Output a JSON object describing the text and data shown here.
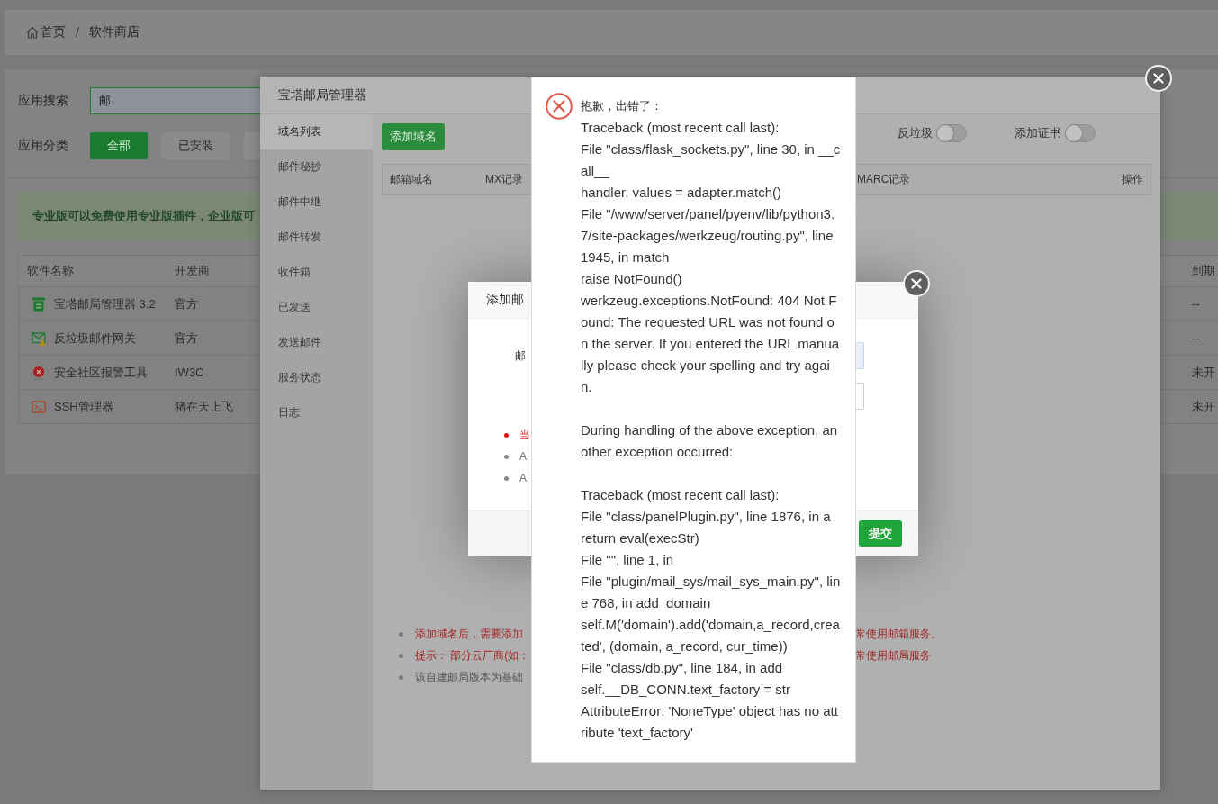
{
  "breadcrumb": {
    "items": [
      "首页",
      "软件商店"
    ],
    "separator": "/"
  },
  "search": {
    "label": "应用搜索",
    "value": "邮"
  },
  "category": {
    "label": "应用分类",
    "options": [
      {
        "label": "全部",
        "selected": true
      },
      {
        "label": "已安装",
        "selected": false
      },
      {
        "selected": false
      }
    ]
  },
  "banner": {
    "text": "专业版可以免费使用专业版插件，企业版可"
  },
  "software_table": {
    "columns": [
      "软件名称",
      "开发商"
    ],
    "column_right": "到期",
    "rows": [
      {
        "name": "宝塔邮局管理器 3.2",
        "developer": "官方",
        "expiry": "--"
      },
      {
        "name": "反垃圾邮件网关",
        "developer": "官方",
        "expiry": "--"
      },
      {
        "name": "安全社区报警工具",
        "developer": "IW3C",
        "expiry": "未开"
      },
      {
        "name": "SSH管理器",
        "developer": "猪在天上飞",
        "expiry": "未开"
      }
    ]
  },
  "mail_manager": {
    "title": "宝塔邮局管理器",
    "menu": [
      {
        "label": "域名列表",
        "selected": true
      },
      {
        "label": "邮件秘抄",
        "selected": false
      },
      {
        "label": "邮件中继",
        "selected": false
      },
      {
        "label": "邮件转发",
        "selected": false
      },
      {
        "label": "收件箱",
        "selected": false
      },
      {
        "label": "已发送",
        "selected": false
      },
      {
        "label": "发送邮件",
        "selected": false
      },
      {
        "label": "服务状态",
        "selected": false
      },
      {
        "label": "日志",
        "selected": false
      }
    ],
    "add_button": "添加域名",
    "switches": [
      {
        "label": "反垃圾",
        "on": false
      },
      {
        "label": "添加证书",
        "on": false
      }
    ],
    "columns_left": [
      "邮箱域名",
      "MX记录"
    ],
    "columns_right": [
      "MARC记录",
      "操作"
    ],
    "notes": [
      {
        "kind": "warning",
        "parts": [
          "添加域名后，需要添加",
          "常使用邮箱服务。"
        ]
      },
      {
        "kind": "warning",
        "parts": [
          "提示： 部分云厂商(如：",
          "常使用邮局服务"
        ]
      },
      {
        "kind": "info",
        "parts": [
          "该自建邮局版本为基础"
        ]
      }
    ]
  },
  "add_mailbox_dialog": {
    "title": "添加邮",
    "fields": [
      {
        "label": "邮",
        "autofilled": true
      },
      {
        "autofilled": false
      }
    ],
    "tips": [
      {
        "kind": "warning",
        "text": "当"
      },
      {
        "kind": "info",
        "text": "A"
      },
      {
        "kind": "info",
        "text": "A"
      }
    ],
    "submit": "提交"
  },
  "error_dialog": {
    "title": "抱歉，出错了：",
    "sections": [
      [
        "Traceback (most recent call last):",
        "File \"class/flask_sockets.py\", line 30, in __call__",
        "handler, values = adapter.match()",
        "File \"/www/server/panel/pyenv/lib/python3.7/site-packages/werkzeug/routing.py\", line 1945, in match",
        "raise NotFound()",
        "werkzeug.exceptions.NotFound: 404 Not Found: The requested URL was not found on the server. If you entered the URL manually please check your spelling and try again."
      ],
      [
        "During handling of the above exception, another exception occurred:"
      ],
      [
        "Traceback (most recent call last):",
        "File \"class/panelPlugin.py\", line 1876, in a",
        "return eval(execStr)",
        "File \"\", line 1, in",
        "File \"plugin/mail_sys/mail_sys_main.py\", line 768, in add_domain",
        "self.M('domain').add('domain,a_record,created', (domain, a_record, cur_time))",
        "File \"class/db.py\", line 184, in add",
        "self.__DB_CONN.text_factory = str",
        "AttributeError: 'NoneType' object has no attribute 'text_factory'"
      ]
    ]
  }
}
